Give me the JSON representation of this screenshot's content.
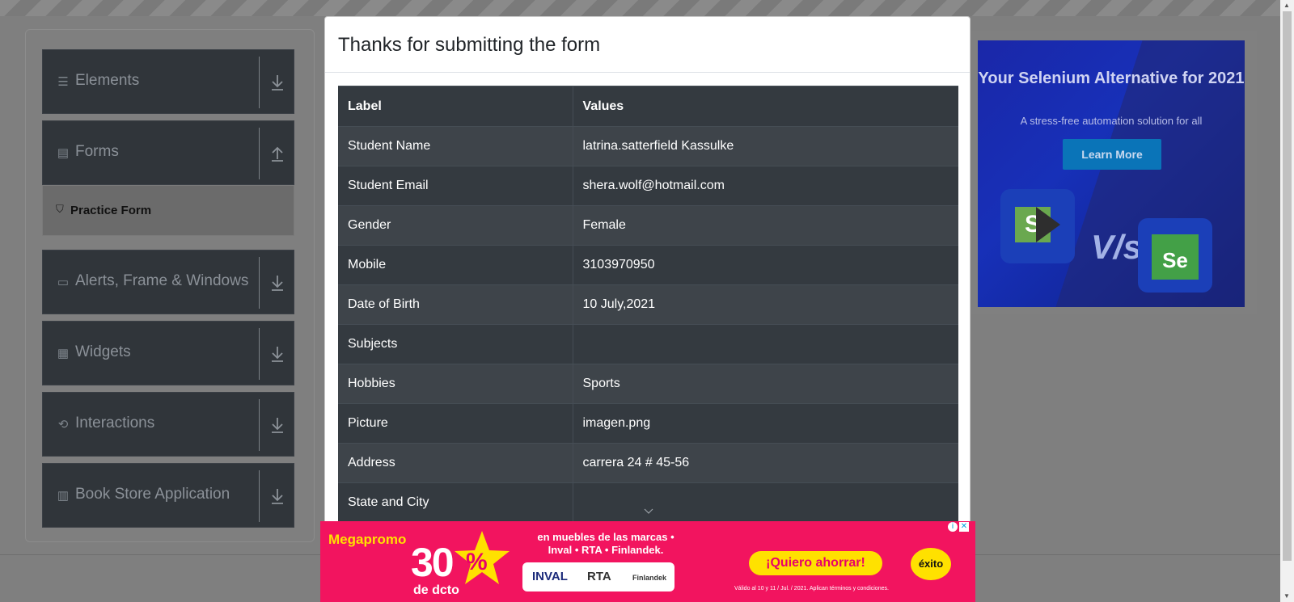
{
  "sidebar": {
    "groups": [
      {
        "label": "Elements",
        "icon": "list-icon",
        "arrow": "down"
      },
      {
        "label": "Forms",
        "icon": "document-icon",
        "arrow": "up"
      },
      {
        "label": "Alerts, Frame & Windows",
        "icon": "window-icon",
        "arrow": "down"
      },
      {
        "label": "Widgets",
        "icon": "widgets-icon",
        "arrow": "down"
      },
      {
        "label": "Interactions",
        "icon": "interactions-icon",
        "arrow": "down"
      },
      {
        "label": "Book Store Application",
        "icon": "books-icon",
        "arrow": "down"
      }
    ],
    "active_item": {
      "label": "Practice Form",
      "icon": "html5-icon"
    }
  },
  "ad_right": {
    "title": "Your Selenium Alternative for 2021",
    "subtitle": "A stress-free automation solution for all",
    "button": "Learn More",
    "vs": "V/s",
    "logo_left": "S",
    "logo_right": "Se"
  },
  "modal": {
    "title": "Thanks for submitting the form",
    "table": {
      "headers": [
        "Label",
        "Values"
      ],
      "rows": [
        [
          "Student Name",
          "latrina.satterfield Kassulke"
        ],
        [
          "Student Email",
          "shera.wolf@hotmail.com"
        ],
        [
          "Gender",
          "Female"
        ],
        [
          "Mobile",
          "3103970950"
        ],
        [
          "Date of Birth",
          "10 July,2021"
        ],
        [
          "Subjects",
          ""
        ],
        [
          "Hobbies",
          "Sports"
        ],
        [
          "Picture",
          "imagen.png"
        ],
        [
          "Address",
          "carrera 24 # 45-56"
        ],
        [
          "State and City",
          ""
        ]
      ]
    }
  },
  "ad_bottom": {
    "brand": "Megapromo",
    "discount": "30",
    "percent": "%",
    "discount_suffix": "de dcto",
    "marcas": "en muebles de las marcas • Inval • RTA • Finlandek.",
    "brand1": "INVAL",
    "brand2": "RTA",
    "brand3": "Finlandek",
    "cta": "¡Quiero ahorrar!",
    "store": "éxito",
    "legal": "Válido al 10 y 11 / Jul. / 2021. Aplican términos y condiciones.",
    "close": "✕",
    "info": "i"
  }
}
